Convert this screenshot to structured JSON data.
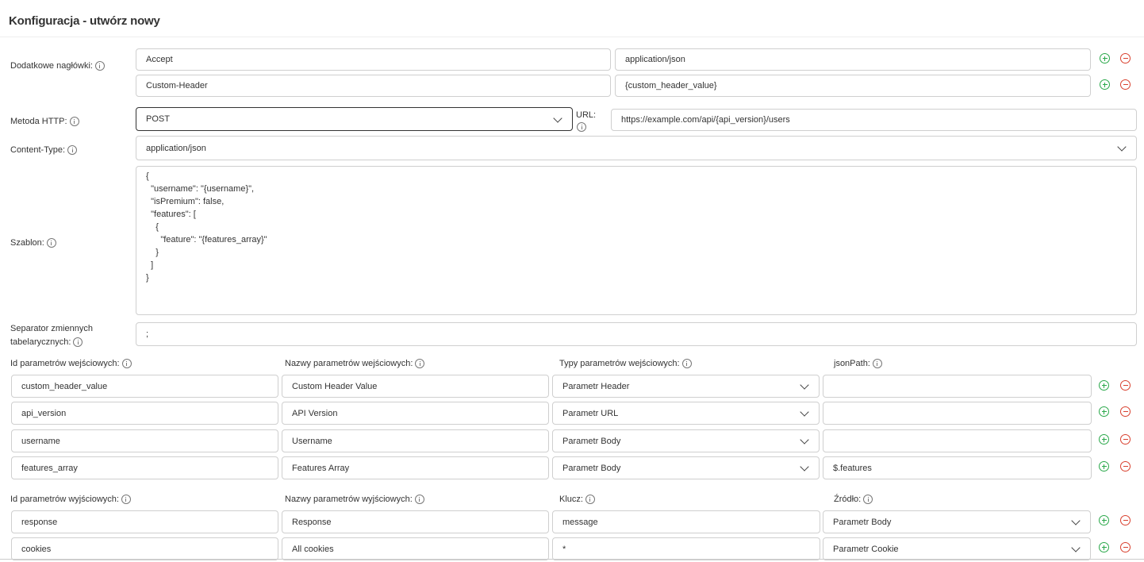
{
  "page": {
    "title": "Konfiguracja - utwórz nowy"
  },
  "headers": {
    "label": "Dodatkowe nagłówki:",
    "rows": [
      {
        "name": "Accept",
        "value": "application/json"
      },
      {
        "name": "Custom-Header",
        "value": "{custom_header_value}"
      }
    ]
  },
  "method": {
    "label": "Metoda HTTP:",
    "value": "POST"
  },
  "url": {
    "label": "URL:",
    "value": "https://example.com/api/{api_version}/users"
  },
  "content_type": {
    "label": "Content-Type:",
    "value": "application/json"
  },
  "template": {
    "label": "Szablon:",
    "text": "{\n  \"username\": \"{username}\",\n  \"isPremium\": false,\n  \"features\": [\n    {\n      \"feature\": \"{features_array}\"\n    }\n  ]\n}"
  },
  "separator": {
    "label_line1": "Separator zmiennych",
    "label_line2": "tabelarycznych:",
    "value": ";"
  },
  "input_params": {
    "col_id": "Id parametrów wejściowych:",
    "col_name": "Nazwy parametrów wejściowych:",
    "col_type": "Typy parametrów wejściowych:",
    "col_path": "jsonPath:",
    "rows": [
      {
        "id": "custom_header_value",
        "name": "Custom Header Value",
        "type": "Parametr Header",
        "path": ""
      },
      {
        "id": "api_version",
        "name": "API Version",
        "type": "Parametr URL",
        "path": ""
      },
      {
        "id": "username",
        "name": "Username",
        "type": "Parametr Body",
        "path": ""
      },
      {
        "id": "features_array",
        "name": "Features Array",
        "type": "Parametr Body",
        "path": "$.features"
      }
    ]
  },
  "output_params": {
    "col_id": "Id parametrów wyjściowych:",
    "col_name": "Nazwy parametrów wyjściowych:",
    "col_key": "Klucz:",
    "col_source": "Źródło:",
    "rows": [
      {
        "id": "response",
        "name": "Response",
        "key": "message",
        "source": "Parametr Body"
      },
      {
        "id": "cookies",
        "name": "All cookies",
        "key": "*",
        "source": "Parametr Cookie"
      }
    ]
  },
  "icons": {
    "info": "info-icon",
    "add": "plus-circle-icon",
    "remove": "minus-circle-icon",
    "dropdown": "chevron-down-icon"
  },
  "colors": {
    "add": "#2aa84a",
    "remove": "#d9412f",
    "border": "#cfcfcf"
  }
}
